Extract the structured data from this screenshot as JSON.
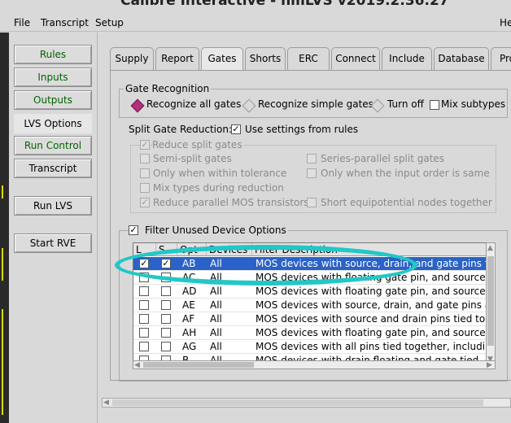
{
  "window": {
    "title": "Calibre Interactive - nmLVS v2019.2.36.27"
  },
  "menubar": {
    "file": "File",
    "transcript": "Transcript",
    "setup": "Setup",
    "help": "He"
  },
  "sidebar": {
    "rules": "Rules",
    "inputs": "Inputs",
    "outputs": "Outputs",
    "lvs_options": "LVS Options",
    "run_control": "Run Control",
    "transcript": "Transcript",
    "run_lvs": "Run LVS",
    "start_rve": "Start RVE"
  },
  "tabs": [
    "Supply",
    "Report",
    "Gates",
    "Shorts",
    "ERC",
    "Connect",
    "Include",
    "Database",
    "Pro"
  ],
  "active_tab": "Gates",
  "gate_recognition": {
    "legend": "Gate Recognition",
    "options": [
      "Recognize all gates",
      "Recognize simple gates",
      "Turn off"
    ],
    "selected": "Recognize all gates",
    "mix_subtypes": "Mix subtypes"
  },
  "split_gate": {
    "label": "Split Gate Reduction:",
    "use_settings": "Use settings from rules",
    "reduce": "Reduce split gates",
    "options_left": [
      "Semi-split gates",
      "Only when within tolerance",
      "Mix types during reduction",
      "Reduce parallel MOS transistors"
    ],
    "options_right": [
      "Series-parallel split gates",
      "Only when the input order is same",
      "Short equipotential nodes together"
    ]
  },
  "filter": {
    "legend": "Filter Unused Device Options",
    "columns": [
      "L",
      "S",
      "Opt",
      "Devices",
      "Filter Description"
    ],
    "rows": [
      {
        "l": true,
        "s": true,
        "opt": "AB",
        "devices": "All",
        "desc": "MOS devices with source, drain, and gate pins tied together"
      },
      {
        "l": false,
        "s": false,
        "opt": "AC",
        "devices": "All",
        "desc": "MOS devices with floating gate pin, and source and drain"
      },
      {
        "l": false,
        "s": false,
        "opt": "AD",
        "devices": "All",
        "desc": "MOS devices with floating gate pin, and source and drain"
      },
      {
        "l": false,
        "s": false,
        "opt": "AE",
        "devices": "All",
        "desc": "MOS devices with source, drain, and gate pins all floating"
      },
      {
        "l": false,
        "s": false,
        "opt": "AF",
        "devices": "All",
        "desc": "MOS devices with source and drain pins tied together"
      },
      {
        "l": false,
        "s": false,
        "opt": "AH",
        "devices": "All",
        "desc": "MOS devices with floating gate pin, and source, drain"
      },
      {
        "l": false,
        "s": false,
        "opt": "AG",
        "devices": "All",
        "desc": "MOS devices with all pins tied together, including bulk"
      },
      {
        "l": false,
        "s": false,
        "opt": "B",
        "devices": "All",
        "desc": "MOS devices with drain floating and gate tied"
      }
    ]
  },
  "colors": {
    "highlight": "#22c7c7",
    "selection": "#2a62c7",
    "radio_on": "#b0307a",
    "nav_text": "#006400"
  }
}
